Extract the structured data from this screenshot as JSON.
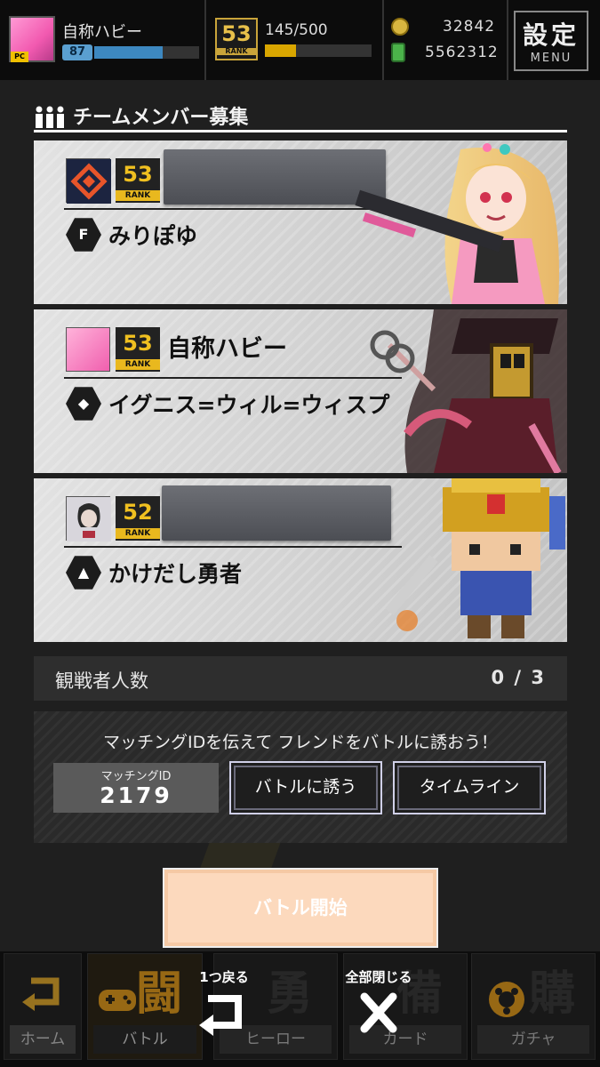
{
  "topbar": {
    "player_name": "自称ハビー",
    "player_level": "87",
    "player_level_progress": 0.65,
    "rank_value": "53",
    "rank_label": "RANK",
    "exp_text": "145/500",
    "exp_progress": 0.29,
    "coins": "32842",
    "gems": "5562312",
    "settings_kanji": "設定",
    "settings_label": "MENU",
    "pc_badge": "PC"
  },
  "section": {
    "title": "チームメンバー募集"
  },
  "members": [
    {
      "rank": "53",
      "rank_label": "RANK",
      "name": "",
      "name_redacted": true,
      "hero_icon": "F",
      "hero_name": "みりぽゆ",
      "accent": "#e85a8c"
    },
    {
      "rank": "53",
      "rank_label": "RANK",
      "name": "自称ハビー",
      "name_redacted": false,
      "hero_icon": "◆",
      "hero_name": "イグニス=ウィル=ウィスプ",
      "accent": "#8a2f3a"
    },
    {
      "rank": "52",
      "rank_label": "RANK",
      "name": "",
      "name_redacted": true,
      "hero_icon": "▲",
      "hero_name": "かけだし勇者",
      "accent": "#d4a020"
    }
  ],
  "spectators": {
    "label": "観戦者人数",
    "value": "0 / 3"
  },
  "matching": {
    "message": "マッチングIDを伝えて フレンドをバトルに誘おう！",
    "id_label": "マッチングID",
    "id_value": "2179",
    "invite_label": "バトルに誘う",
    "timeline_label": "タイムライン"
  },
  "start_button": "バトル開始",
  "nav": [
    {
      "kanji": "",
      "label": "ホーム"
    },
    {
      "kanji": "闘",
      "label": "バトル"
    },
    {
      "kanji": "勇",
      "label": "ヒーロー"
    },
    {
      "kanji": "備",
      "label": "カード"
    },
    {
      "kanji": "購",
      "label": "ガチャ"
    }
  ],
  "overlay": {
    "back_label": "1つ戻る",
    "close_label": "全部閉じる"
  }
}
